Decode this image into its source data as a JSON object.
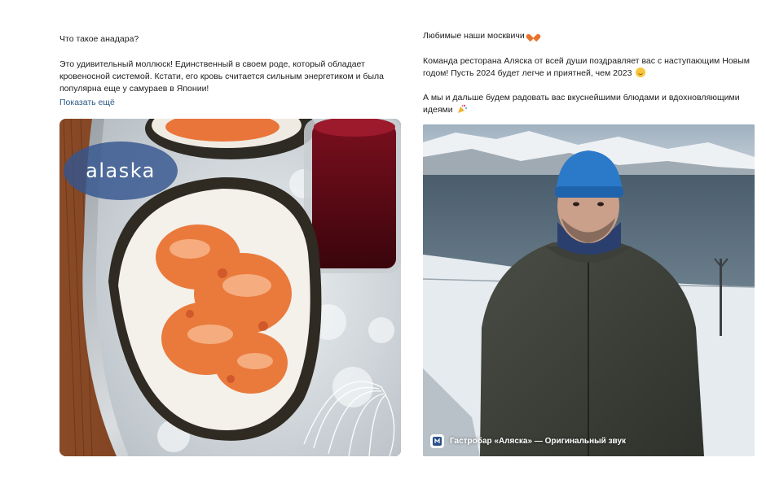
{
  "posts": [
    {
      "title": "Что такое анадара?",
      "body": "Это удивительный моллюск! Единственный в своем роде, который обладает кровеносной системой. Кстати, его кровь считается сильным энергетиком и была популярна еще у самураев в Японии!",
      "show_more": "Показать ещё",
      "image_logo": "alaska"
    },
    {
      "greeting": "Любимые наши москвичи",
      "paragraph1": "Команда ресторана Аляска от всей души поздравляет вас с наступающим Новым годом! Пусть 2024 будет легче и приятней, чем 2023",
      "paragraph2": "А мы и дальше будем радовать вас вкуснейшими блюдами и вдохновляющими идеями",
      "audio_label": "Гастробар «Аляска» — Оригинальный звук"
    }
  ],
  "colors": {
    "link": "#2a5885",
    "text": "#1c1c1c",
    "badge": "#34568f"
  },
  "icons": {
    "heart": "orange-heart-icon",
    "smile": "smiling-face-icon",
    "party": "party-popper-icon",
    "audio": "audio-source-icon"
  }
}
